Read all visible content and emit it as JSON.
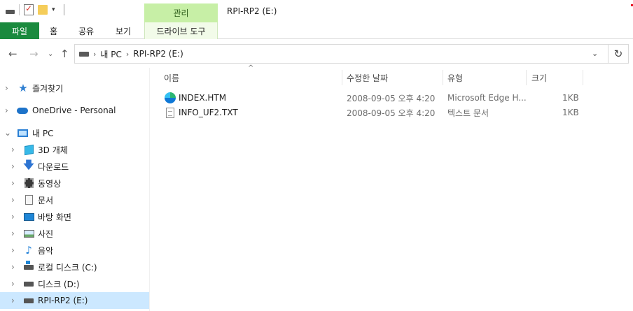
{
  "window": {
    "title": "RPI-RP2 (E:)",
    "context_tab": "관리"
  },
  "ribbon": {
    "file_tab": "파일",
    "tabs": [
      "홈",
      "공유",
      "보기"
    ],
    "context_subtab": "드라이브 도구",
    "file_tab_color": "#1a8a3e",
    "context_color": "#c7efa6"
  },
  "address": {
    "crumbs": [
      "내 PC",
      "RPI-RP2 (E:)"
    ]
  },
  "nav": {
    "items": [
      {
        "label": "즐겨찾기",
        "icon": "star-icon"
      },
      {
        "label": "OneDrive - Personal",
        "icon": "cloud-icon"
      },
      {
        "label": "내 PC",
        "icon": "computer-icon"
      },
      {
        "label": "3D 개체",
        "icon": "cube-icon"
      },
      {
        "label": "다운로드",
        "icon": "download-arrow-icon"
      },
      {
        "label": "동영상",
        "icon": "video-icon"
      },
      {
        "label": "문서",
        "icon": "document-icon"
      },
      {
        "label": "바탕 화면",
        "icon": "desktop-icon"
      },
      {
        "label": "사진",
        "icon": "picture-icon"
      },
      {
        "label": "음악",
        "icon": "music-note-icon"
      },
      {
        "label": "로컬 디스크 (C:)",
        "icon": "windows-drive-icon"
      },
      {
        "label": "디스크 (D:)",
        "icon": "drive-icon"
      },
      {
        "label": "RPI-RP2 (E:)",
        "icon": "drive-icon"
      }
    ],
    "selected_color": "#cce8ff"
  },
  "columns": {
    "name": "이름",
    "modified": "수정한 날짜",
    "type": "유형",
    "size": "크기"
  },
  "files": [
    {
      "name": "INDEX.HTM",
      "modified": "2008-09-05 오후 4:20",
      "type": "Microsoft Edge H...",
      "size": "1KB",
      "icon": "edge-icon"
    },
    {
      "name": "INFO_UF2.TXT",
      "modified": "2008-09-05 오후 4:20",
      "type": "텍스트 문서",
      "size": "1KB",
      "icon": "text-file-icon"
    }
  ]
}
